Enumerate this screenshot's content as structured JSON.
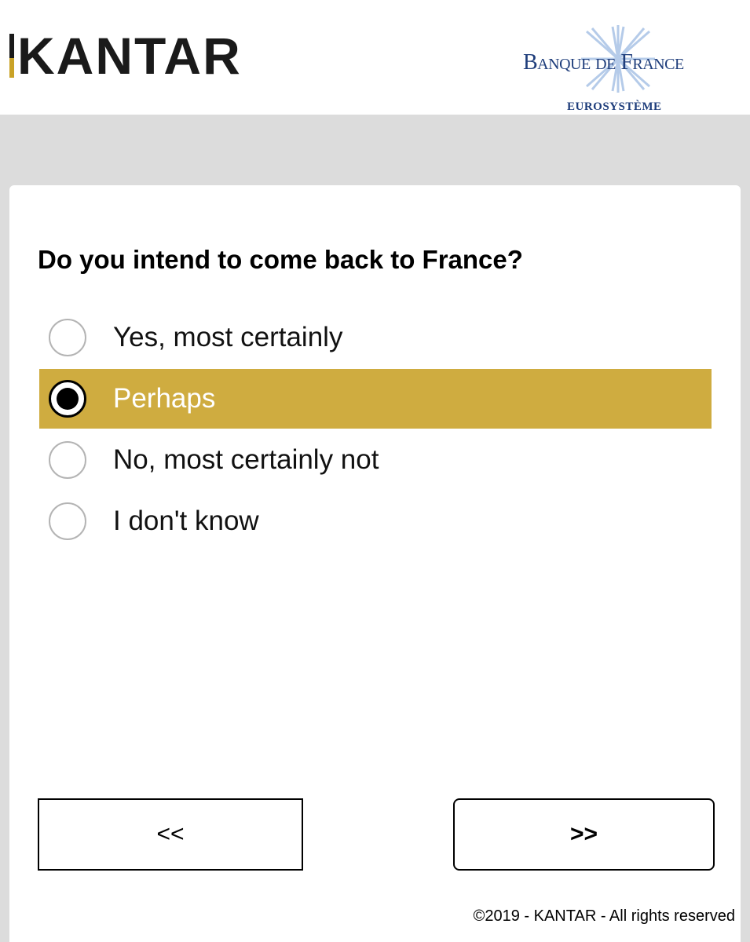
{
  "header": {
    "kantar_logo_text": "KANTAR",
    "bdf_name": "Banque de France",
    "bdf_subtitle": "EUROSYSTÈME"
  },
  "question": {
    "text": "Do you intend to come back to France?",
    "options": [
      {
        "label": "Yes, most certainly",
        "selected": false
      },
      {
        "label": "Perhaps",
        "selected": true
      },
      {
        "label": "No, most certainly not",
        "selected": false
      },
      {
        "label": "I don't know",
        "selected": false
      }
    ]
  },
  "navigation": {
    "back_label": "<<",
    "next_label": ">>"
  },
  "footer": {
    "copyright": "©2019 - KANTAR - All rights reserved"
  },
  "colors": {
    "selected_option_bg": "#cfac40",
    "page_bg": "#dcdcdc",
    "brand_blue": "#1e3d7b",
    "brand_gold": "#c9a227"
  }
}
